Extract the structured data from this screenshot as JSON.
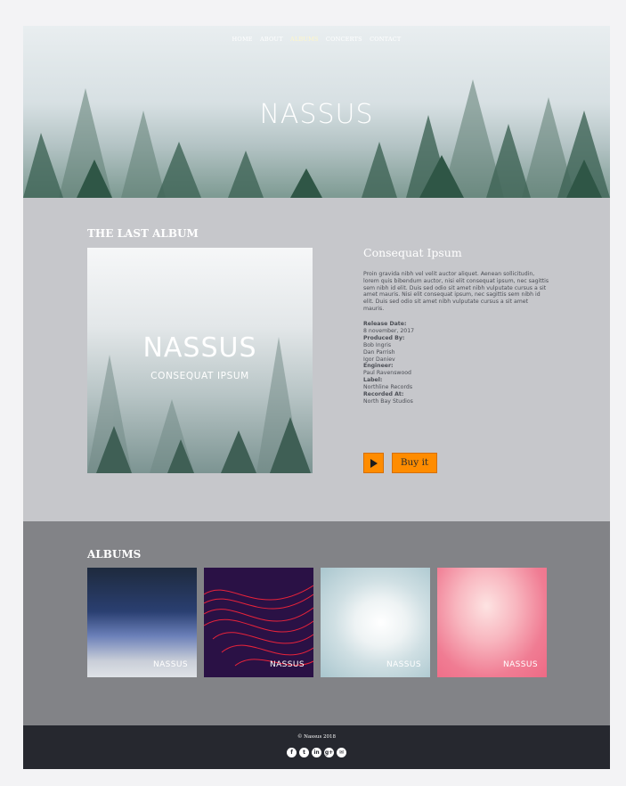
{
  "nav": {
    "items": [
      "HOME",
      "ABOUT",
      "ALBUMS",
      "CONCERTS",
      "CONTACT"
    ],
    "active": "ALBUMS"
  },
  "hero": {
    "logo": "NASSUS"
  },
  "last_album": {
    "section_title": "THE LAST ALBUM",
    "art_logo": "NASSUS",
    "art_subtitle": "CONSEQUAT IPSUM",
    "title": "Consequat Ipsum",
    "description": "Proin gravida nibh vel velit auctor aliquet. Aenean sollicitudin, lorem quis bibendum auctor, nisi elit consequat ipsum, nec sagittis sem nibh id elit. Duis sed odio sit amet nibh vulputate cursus a sit amet mauris. Nisi elit consequat ipsum, nec sagittis sem nibh id elit. Duis sed odio sit amet nibh vulputate cursus a sit amet mauris.",
    "meta": [
      {
        "label": "Release Date:",
        "values": [
          "8 november, 2017"
        ]
      },
      {
        "label": "Produced By:",
        "values": [
          "Bob Ingris",
          "Dan Parrish",
          "Igor Daniev"
        ]
      },
      {
        "label": "Engineer:",
        "values": [
          "Paul Ravenswood"
        ]
      },
      {
        "label": "Label:",
        "values": [
          "Northline Records"
        ]
      },
      {
        "label": "Recorded At:",
        "values": [
          "North Bay Studios"
        ]
      }
    ],
    "buy_label": "Buy it"
  },
  "albums": {
    "section_title": "ALBUMS",
    "items": [
      {
        "logo": "NASSUS"
      },
      {
        "logo": "NASSUS"
      },
      {
        "logo": "NASSUS"
      },
      {
        "logo": "NASSUS"
      }
    ]
  },
  "footer": {
    "copyright": "© Nassus 2018",
    "socials": [
      {
        "icon": "facebook-icon",
        "glyph": "f"
      },
      {
        "icon": "twitter-icon",
        "glyph": "t"
      },
      {
        "icon": "linkedin-icon",
        "glyph": "in"
      },
      {
        "icon": "google-plus-icon",
        "glyph": "g+"
      },
      {
        "icon": "email-icon",
        "glyph": "✉"
      }
    ]
  },
  "colors": {
    "accent": "#ff8c00",
    "content_bg": "#c6c7cb",
    "albums_bg": "#828387",
    "footer_bg": "#26282f"
  }
}
